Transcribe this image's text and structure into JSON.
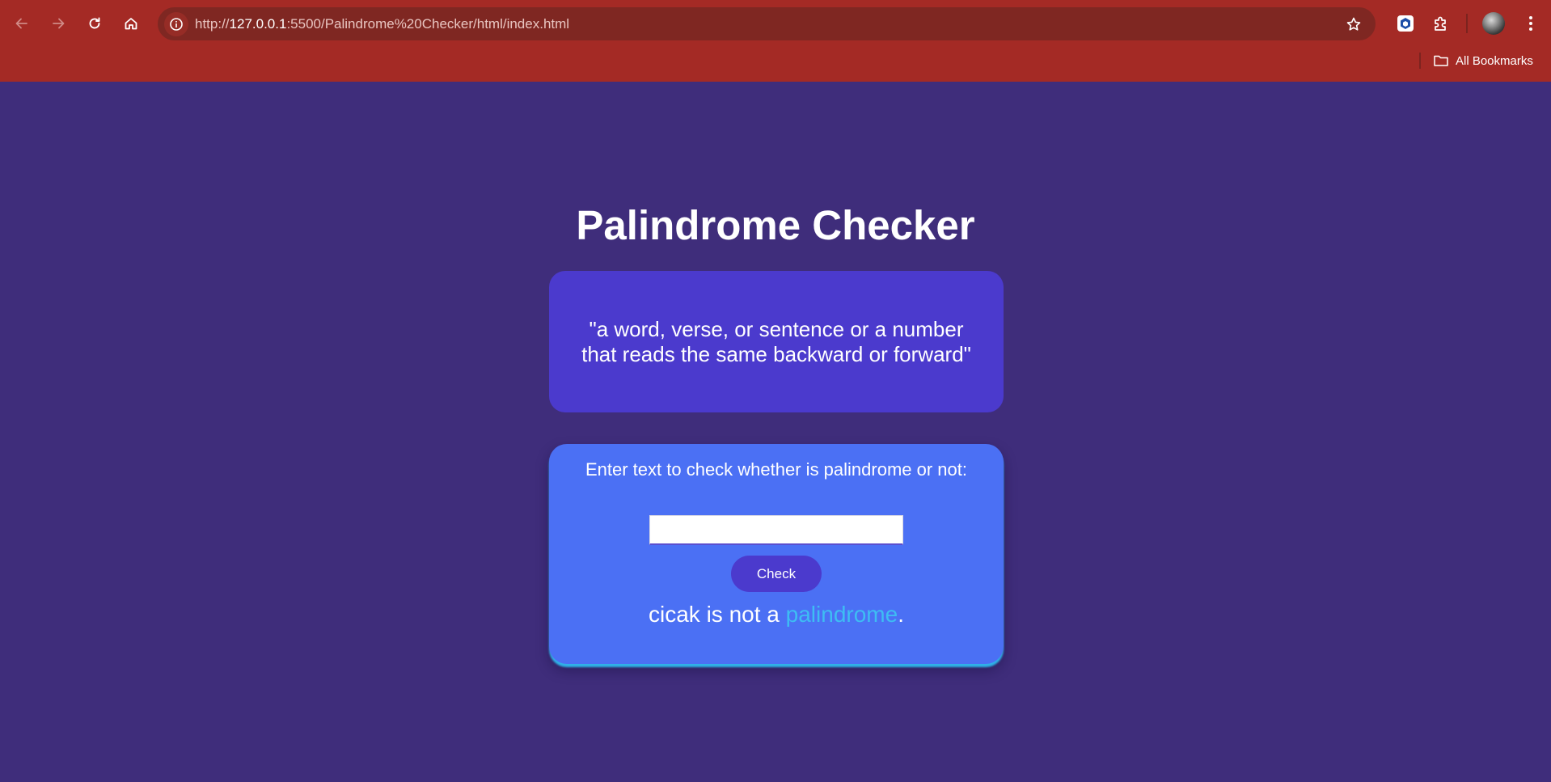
{
  "browser": {
    "url_prefix": "http://",
    "url_host": "127.0.0.1",
    "url_rest": ":5500/Palindrome%20Checker/html/index.html",
    "bookmarks_label": "All Bookmarks",
    "icons": {
      "back": "arrow-left-icon",
      "forward": "arrow-right-icon",
      "reload": "reload-icon",
      "home": "home-icon",
      "site_info": "info-icon",
      "bookmark": "star-icon",
      "extension_1": "extension-logo-icon",
      "extensions": "puzzle-icon",
      "menu": "kebab-menu-icon",
      "folder": "folder-icon"
    },
    "colors": {
      "chrome": "#a42a25",
      "omnibox": "#7f2722"
    }
  },
  "page": {
    "title": "Palindrome Checker",
    "definition": "\"a word, verse, or sentence or a number that reads the same backward or forward\"",
    "prompt": "Enter text to check whether is palindrome or not:",
    "input_value": "",
    "check_button": "Check",
    "result": {
      "prefix": "cicak is not a ",
      "highlight": "palindrome",
      "suffix": "."
    },
    "colors": {
      "background": "#3f2d7b",
      "definition_box": "#4b3acd",
      "checker_box": "#4b70f4",
      "button": "#4b3acd",
      "highlight": "#3ebdf3"
    }
  }
}
